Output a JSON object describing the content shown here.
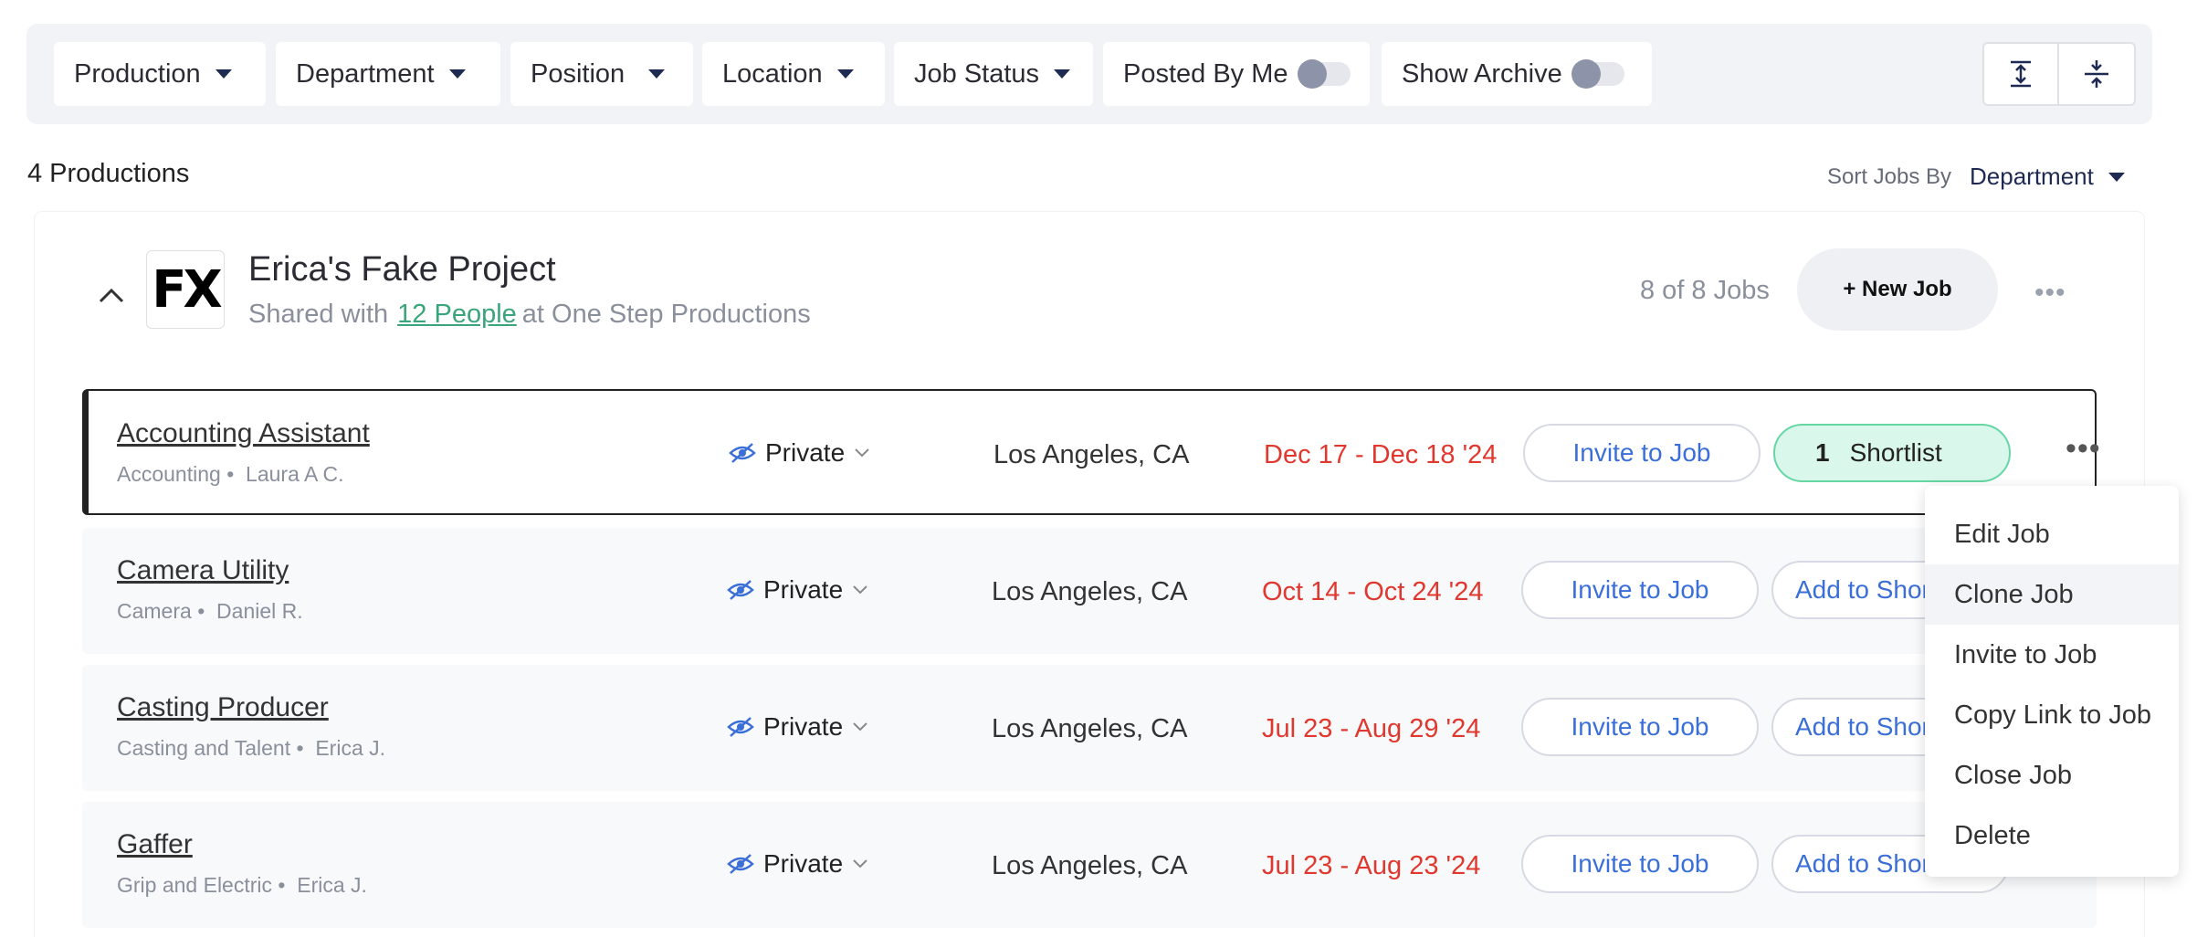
{
  "filters": {
    "production": "Production",
    "department": "Department",
    "position": "Position",
    "location": "Location",
    "job_status": "Job Status",
    "posted_by_me": "Posted By Me",
    "show_archive": "Show Archive"
  },
  "summary": {
    "count_label": "4 Productions",
    "sort_label": "Sort Jobs By",
    "sort_value": "Department"
  },
  "production": {
    "logo_text": "FX",
    "title": "Erica's Fake Project",
    "shared_prefix": "Shared with",
    "shared_link": "12 People",
    "shared_suffix": "at One Step Productions",
    "jobs_count": "8 of 8 Jobs",
    "new_job_label": "+ New Job"
  },
  "jobs": [
    {
      "title": "Accounting Assistant",
      "department": "Accounting",
      "person": "Laura A C.",
      "visibility": "Private",
      "location": "Los Angeles, CA",
      "dates": "Dec 17 - Dec 18 '24",
      "invite": "Invite to Job",
      "shortlist_count": "1",
      "shortlist_label": "Shortlist"
    },
    {
      "title": "Camera Utility",
      "department": "Camera",
      "person": "Daniel R.",
      "visibility": "Private",
      "location": "Los Angeles, CA",
      "dates": "Oct 14 - Oct 24 '24",
      "invite": "Invite to Job",
      "shortlist_label": "Add to Shortlist"
    },
    {
      "title": "Casting Producer",
      "department": "Casting and Talent",
      "person": "Erica J.",
      "visibility": "Private",
      "location": "Los Angeles, CA",
      "dates": "Jul 23 - Aug 29 '24",
      "invite": "Invite to Job",
      "shortlist_label": "Add to Shortlist"
    },
    {
      "title": "Gaffer",
      "department": "Grip and Electric",
      "person": "Erica J.",
      "visibility": "Private",
      "location": "Los Angeles, CA",
      "dates": "Jul 23 - Aug 23 '24",
      "invite": "Invite to Job",
      "shortlist_label": "Add to Shortlist"
    }
  ],
  "menu": {
    "items": [
      "Edit Job",
      "Clone Job",
      "Invite to Job",
      "Copy Link to Job",
      "Close Job",
      "Delete"
    ],
    "hovered": "Clone Job"
  },
  "colors": {
    "accent_blue": "#3b6fd8",
    "date_red": "#e0382e",
    "link_green": "#3aa57a",
    "shortlist_active_bg": "#d9f7ea"
  }
}
